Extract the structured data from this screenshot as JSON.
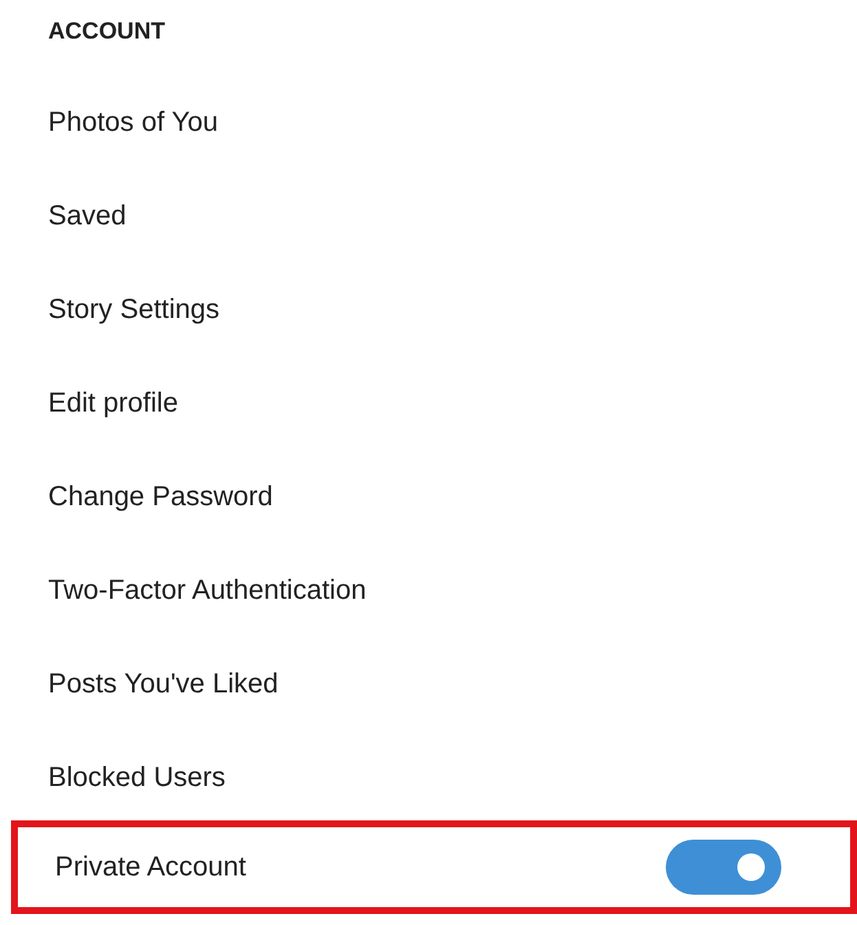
{
  "section_title": "ACCOUNT",
  "items": [
    {
      "label": "Photos of You",
      "kind": "link",
      "highlighted": false
    },
    {
      "label": "Saved",
      "kind": "link",
      "highlighted": false
    },
    {
      "label": "Story Settings",
      "kind": "link",
      "highlighted": false
    },
    {
      "label": "Edit profile",
      "kind": "link",
      "highlighted": false
    },
    {
      "label": "Change Password",
      "kind": "link",
      "highlighted": false
    },
    {
      "label": "Two-Factor Authentication",
      "kind": "link",
      "highlighted": false
    },
    {
      "label": "Posts You've Liked",
      "kind": "link",
      "highlighted": false
    },
    {
      "label": "Blocked Users",
      "kind": "link",
      "highlighted": false
    },
    {
      "label": "Private Account",
      "kind": "toggle",
      "on": true,
      "highlighted": true
    }
  ]
}
